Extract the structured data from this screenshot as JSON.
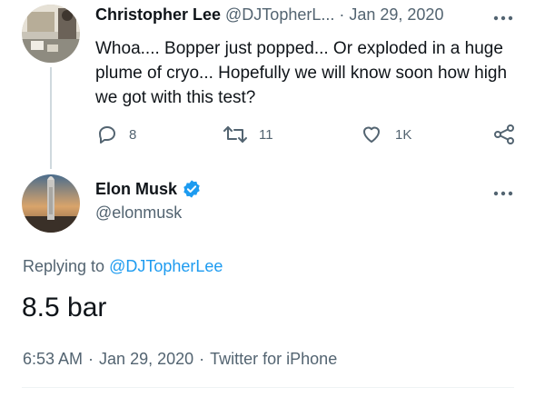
{
  "tweet1": {
    "author_name": "Christopher Lee",
    "author_handle": "@DJTopherL...",
    "separator": "·",
    "date": "Jan 29, 2020",
    "text": "Whoa.... Bopper just popped... Or exploded in a huge plume of cryo... Hopefully we will know soon how high we got with this test?",
    "more_icon": "more-horizontal-icon",
    "actions": {
      "reply_count": "8",
      "retweet_count": "11",
      "like_count": "1K"
    }
  },
  "tweet2": {
    "author_name": "Elon Musk",
    "author_handle": "@elonmusk",
    "verified": true,
    "more_icon": "more-horizontal-icon",
    "replying_prefix": "Replying to",
    "replying_handle": "@DJTopherLee",
    "text": "8.5 bar",
    "time": "6:53 AM",
    "date": "Jan 29, 2020",
    "source": "Twitter for iPhone",
    "separator": "·"
  },
  "colors": {
    "text_primary": "#0f1419",
    "text_secondary": "#536471",
    "accent": "#1d9bf0",
    "thread_line": "#cfd9de"
  }
}
